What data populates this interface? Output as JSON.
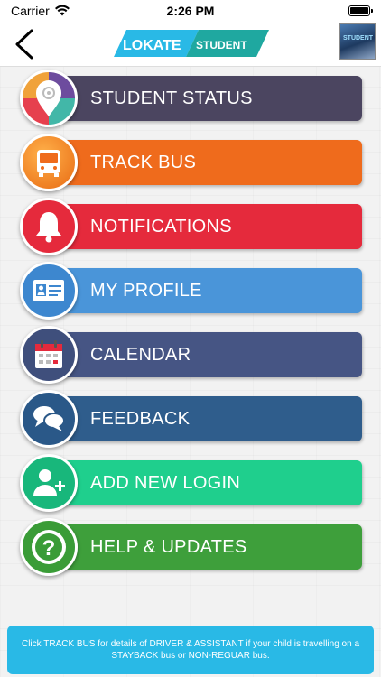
{
  "status_bar": {
    "carrier": "Carrier",
    "time": "2:26 PM"
  },
  "header": {
    "logo_left": "LOKATE",
    "logo_right": "STUDENT",
    "profile_text": "STUDENT"
  },
  "menu": {
    "items": [
      {
        "label": "STUDENT STATUS",
        "color": "#4b4560",
        "icon": "location-pin-icon"
      },
      {
        "label": "TRACK BUS",
        "color": "#ef6b1c",
        "icon": "bus-icon"
      },
      {
        "label": "NOTIFICATIONS",
        "color": "#e52a3c",
        "icon": "bell-icon"
      },
      {
        "label": "MY PROFILE",
        "color": "#4a95d9",
        "icon": "id-card-icon"
      },
      {
        "label": "CALENDAR",
        "color": "#465584",
        "icon": "calendar-icon"
      },
      {
        "label": "FEEDBACK",
        "color": "#2f5d8c",
        "icon": "chat-bubbles-icon"
      },
      {
        "label": "ADD NEW LOGIN",
        "color": "#1fcf8d",
        "icon": "add-user-icon"
      },
      {
        "label": "HELP & UPDATES",
        "color": "#3e9f3b",
        "icon": "question-icon"
      }
    ]
  },
  "footer": {
    "message": "Click TRACK BUS for details of DRIVER & ASSISTANT if your child is travelling on a STAYBACK bus or NON-REGUAR bus."
  }
}
